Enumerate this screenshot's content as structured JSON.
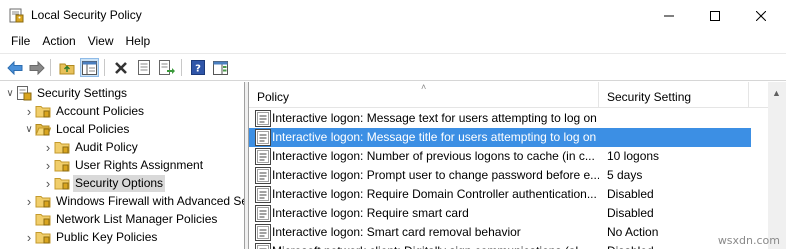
{
  "window": {
    "title": "Local Security Policy"
  },
  "menu": [
    "File",
    "Action",
    "View",
    "Help"
  ],
  "tree": {
    "items": [
      {
        "label": "Security Settings",
        "level": 0,
        "expander": "expanded",
        "icon": "security-settings-icon"
      },
      {
        "label": "Account Policies",
        "level": 1,
        "expander": "collapsed",
        "icon": "folder-icon"
      },
      {
        "label": "Local Policies",
        "level": 1,
        "expander": "expanded",
        "icon": "folder-open-icon"
      },
      {
        "label": "Audit Policy",
        "level": 2,
        "expander": "collapsed",
        "icon": "folder-icon"
      },
      {
        "label": "User Rights Assignment",
        "level": 2,
        "expander": "collapsed",
        "icon": "folder-icon"
      },
      {
        "label": "Security Options",
        "level": 2,
        "expander": "collapsed",
        "icon": "folder-icon",
        "selected": true
      },
      {
        "label": "Windows Firewall with Advanced Secu",
        "level": 1,
        "expander": "collapsed",
        "icon": "folder-icon"
      },
      {
        "label": "Network List Manager Policies",
        "level": 1,
        "expander": "none",
        "icon": "folder-icon"
      },
      {
        "label": "Public Key Policies",
        "level": 1,
        "expander": "collapsed",
        "icon": "folder-icon"
      }
    ]
  },
  "list": {
    "columns": {
      "policy": "Policy",
      "setting": "Security Setting"
    },
    "rows": [
      {
        "policy": "Interactive logon: Message text for users attempting to log on",
        "setting": ""
      },
      {
        "policy": "Interactive logon: Message title for users attempting to log on",
        "setting": "",
        "selected": true
      },
      {
        "policy": "Interactive logon: Number of previous logons to cache (in c...",
        "setting": "10 logons"
      },
      {
        "policy": "Interactive logon: Prompt user to change password before e...",
        "setting": "5 days"
      },
      {
        "policy": "Interactive logon: Require Domain Controller authentication...",
        "setting": "Disabled"
      },
      {
        "policy": "Interactive logon: Require smart card",
        "setting": "Disabled"
      },
      {
        "policy": "Interactive logon: Smart card removal behavior",
        "setting": "No Action"
      },
      {
        "policy": "Microsoft network client: Digitally sign communications (al...",
        "setting": "Disabled"
      }
    ]
  },
  "colors": {
    "selection": "#3c8fe4",
    "tree_selection": "#d9d9d9",
    "folder": "#e8c15a"
  },
  "watermark": "wsxdn.com"
}
